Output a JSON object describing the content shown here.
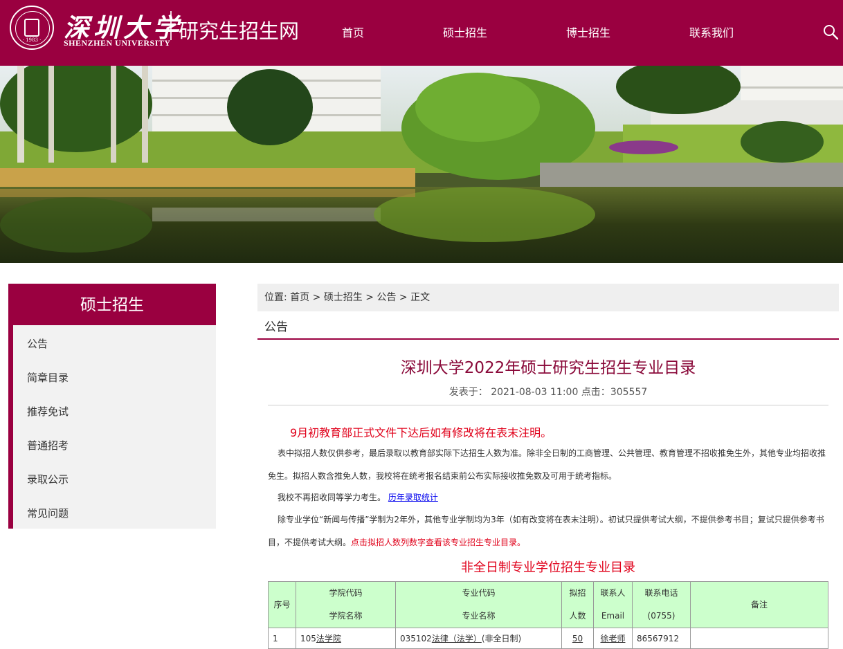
{
  "header": {
    "logo_cn": "深圳大学",
    "logo_en": "SHENZHEN UNIVERSITY",
    "seal_year": "· 1983 ·",
    "site_name": "研究生招生网",
    "nav": [
      "首页",
      "硕士招生",
      "博士招生",
      "联系我们"
    ],
    "search_icon": "search-icon"
  },
  "sidebar": {
    "title": "硕士招生",
    "items": [
      "公告",
      "简章目录",
      "推荐免试",
      "普通招考",
      "录取公示",
      "常见问题"
    ]
  },
  "breadcrumb": {
    "prefix": "位置:",
    "items": [
      "首页",
      "硕士招生",
      "公告",
      "正文"
    ],
    "sep": ">"
  },
  "section": {
    "title": "公告"
  },
  "article": {
    "title": "深圳大学2022年硕士研究生招生专业目录",
    "published_label": "发表于：",
    "published": "2021-08-03 11:00",
    "clicks_label": "点击：",
    "clicks": "305557",
    "notice_red": "9月初教育部正式文件下达后如有修改将在表末注明。",
    "para1": "表中拟招人数仅供参考，最后录取以教育部实际下达招生人数为准。除非全日制的工商管理、公共管理、教育管理不招收推免生外，其他专业均招收推免生。拟招人数含推免人数，我校将在统考报名结束前公布实际接收推免数及可用于统考指标。",
    "para2_text": "我校不再招收同等学力考生。",
    "para2_link": "历年录取统计",
    "para3_text": "除专业学位“新闻与传播”学制为2年外，其他专业学制均为3年（如有改变将在表末注明）。初试只提供考试大纲，不提供参考书目；复试只提供参考书目，不提供考试大纲。",
    "para3_red": "点击拟招人数列数字查看该专业招生专业目录。",
    "table_title": "非全日制专业学位招生专业目录"
  },
  "table": {
    "headers": {
      "no": "序号",
      "college_code": "学院代码",
      "college_name": "学院名称",
      "major_code": "专业代码",
      "major_name": "专业名称",
      "plan_1": "拟招",
      "plan_2": "人数",
      "contact_1": "联系人",
      "contact_2": "Email",
      "phone_1": "联系电话",
      "phone_2": "(0755)",
      "remark": "备注"
    },
    "rows": [
      {
        "no": "1",
        "college_code": "105",
        "college_name": "法学院",
        "major_code": "035102",
        "major_name": "法律（法学）",
        "major_suffix": "(非全日制)",
        "plan": "50",
        "contact": "徐老师",
        "phone": "86567912",
        "remark": ""
      }
    ]
  }
}
